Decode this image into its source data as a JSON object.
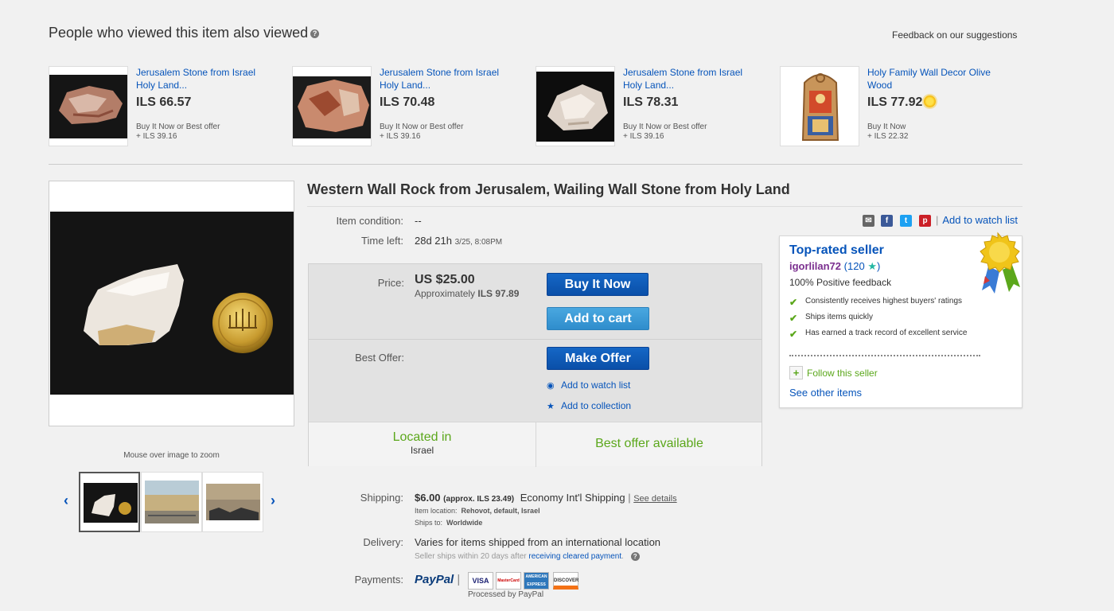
{
  "also_viewed": {
    "title": "People who viewed this item also viewed",
    "feedback_link": "Feedback on our suggestions",
    "items": [
      {
        "title": "Jerusalem Stone from Israel Holy Land...",
        "price": "ILS 66.57",
        "format": "Buy It Now or Best offer",
        "shipping": "+ ILS 39.16"
      },
      {
        "title": "Jerusalem Stone from Israel Holy Land...",
        "price": "ILS 70.48",
        "format": "Buy It Now or Best offer",
        "shipping": "+ ILS 39.16"
      },
      {
        "title": "Jerusalem Stone from Israel Holy Land...",
        "price": "ILS 78.31",
        "format": "Buy It Now or Best offer",
        "shipping": "+ ILS 39.16"
      },
      {
        "title": "Holy Family Wall Decor Olive Wood",
        "price": "ILS 77.92",
        "format": "Buy It Now",
        "shipping": "+ ILS 22.32"
      }
    ]
  },
  "gallery": {
    "zoom_hint": "Mouse over image to zoom"
  },
  "item": {
    "title": "Western Wall Rock from Jerusalem, Wailing Wall Stone from Holy Land",
    "condition_label": "Item condition:",
    "condition_value": "--",
    "time_left_label": "Time left:",
    "time_left_value": "28d 21h",
    "time_left_end": "3/25, 8:08PM",
    "add_to_watch_list": "Add to watch list",
    "price_label": "Price:",
    "price_value": "US $25.00",
    "approx_label": "Approximately",
    "approx_value": "ILS 97.89",
    "buy_it_now": "Buy It Now",
    "add_to_cart": "Add to cart",
    "best_offer_label": "Best Offer:",
    "make_offer": "Make Offer",
    "watch_list_link": "Add to watch list",
    "collection_link": "Add to collection",
    "located_in_label": "Located in",
    "located_in_value": "Israel",
    "best_offer_available": "Best offer available"
  },
  "shipping": {
    "label": "Shipping:",
    "cost": "$6.00",
    "approx": "(approx. ILS 23.49)",
    "method": "Economy Int'l Shipping",
    "see_details": "See details",
    "location_label": "Item location:",
    "location_value": "Rehovot, default, Israel",
    "ships_to_label": "Ships to:",
    "ships_to_value": "Worldwide"
  },
  "delivery": {
    "label": "Delivery:",
    "value": "Varies for items shipped from an international location",
    "note_prefix": "Seller ships within 20 days after",
    "note_link": "receiving cleared payment",
    "note_suffix": "."
  },
  "payments": {
    "label": "Payments:",
    "paypal": "PayPal",
    "processed": "Processed by PayPal",
    "cards": [
      "VISA",
      "MasterCard",
      "AMERICAN EXPRESS",
      "DISCOVER"
    ]
  },
  "seller": {
    "title": "Top-rated seller",
    "username": "igorlilan72",
    "score": "120",
    "positive": "100% Positive feedback",
    "points": [
      "Consistently receives highest buyers' ratings",
      "Ships items quickly",
      "Has earned a track record of excellent service"
    ],
    "follow": "Follow this seller",
    "see_other": "See other items"
  },
  "colors": {
    "link": "#0654ba",
    "green": "#5ba71b",
    "button_dark": "#0654ba",
    "button_light": "#3b9ad8"
  }
}
